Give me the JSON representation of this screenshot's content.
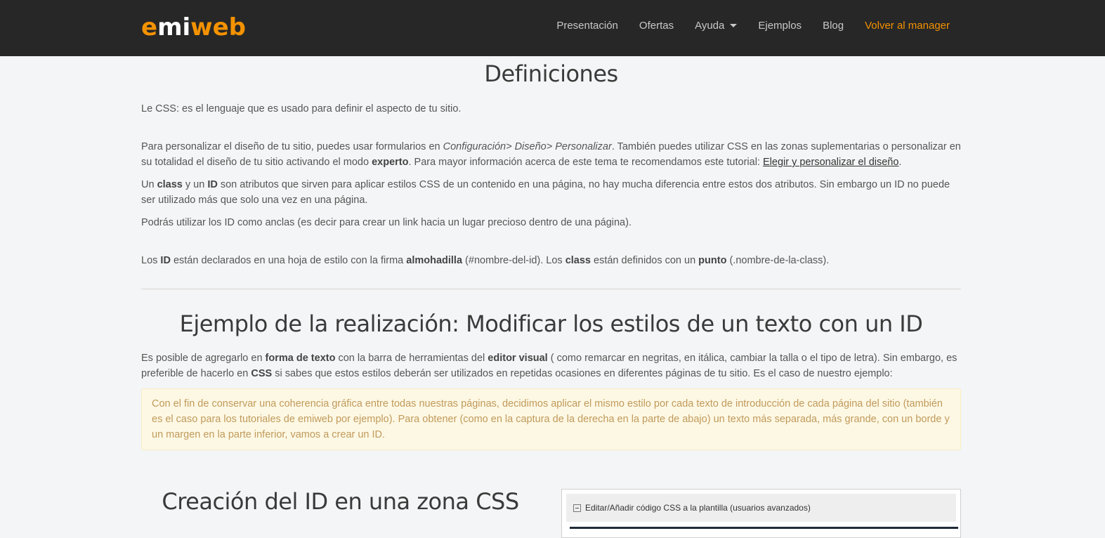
{
  "nav": {
    "logo_part1": "e",
    "logo_part2": "mi",
    "logo_part3": "web",
    "items": [
      "Presentación",
      "Ofertas",
      "Ayuda",
      "Ejemplos",
      "Blog"
    ],
    "manager_link": "Volver al manager"
  },
  "definiciones": {
    "title": "Definiciones",
    "p1": "Le CSS: es el lenguaje que es usado para definir el aspecto de tu sitio.",
    "p2a": "Para personalizar el diseño de tu sitio, puedes usar formularios en ",
    "p2_path": "Configuración> Diseño> Personalizar",
    "p2b": ". También puedes utilizar CSS en las zonas suplementarias o personalizar en su totalidad el diseño de tu sitio activando el modo ",
    "p2_bold": "experto",
    "p2c": ". Para mayor información acerca de este tema te recomendamos este tutorial: ",
    "p2_link": "Elegir y personalizar el diseño",
    "p2d": ".",
    "p3a": "Un ",
    "p3_class": "class",
    "p3b": " y un ",
    "p3_id": "ID",
    "p3c": " son atributos que sirven para aplicar estilos CSS de un contenido en una página, no hay mucha diferencia entre estos dos atributos. Sin embargo un ID no puede ser utilizado más que solo una vez en una página.",
    "p4": "Podrás utilizar los ID como anclas (es decir para crear un link hacia un lugar precioso dentro de una página).",
    "p5a": "Los ",
    "p5_id": "ID",
    "p5b": " están declarados en una hoja de estilo con la firma ",
    "p5_alm": "almohadilla",
    "p5c": " (#nombre-del-id). Los ",
    "p5_class": "class",
    "p5d": " están definidos con un ",
    "p5_punto": "punto",
    "p5e": " (.nombre-de-la-class)."
  },
  "ejemplo": {
    "title": "Ejemplo de la realización: Modificar los estilos de un texto con un ID",
    "p1a": "Es posible de agregarlo en ",
    "p1_forma": "forma de texto",
    "p1b": " con la barra de herramientas del ",
    "p1_editor": "editor visual",
    "p1c": " ( como remarcar en negritas, en itálica, cambiar la talla o el tipo de letra). Sin embargo, es preferible de hacerlo en ",
    "p1_css": "CSS",
    "p1d": " si sabes que estos estilos deberán ser utilizados en repetidas ocasiones en diferentes páginas de tu sitio. Es el caso de nuestro ejemplo:",
    "alert": "Con el fin de conservar una coherencia gráfica entre todas nuestras páginas, decidimos aplicar el mismo estilo por cada texto de introducción de cada página del sitio (también es el caso para los tutoriales de emiweb por ejemplo). Para obtener (como en la captura de la derecha en la parte de abajo) un texto más separada, más grande, con un borde y un margen en la parte inferior, vamos a crear un ID."
  },
  "creacion": {
    "title": "Creación del ID en una zona CSS",
    "panel_label": "Editar/Añadir código CSS a la plantilla (usuarios avanzados)"
  },
  "colors": {
    "accent": "#f39200",
    "navbar": "#272727",
    "alert_bg": "#fdf8e4",
    "alert_text": "#c19a5b"
  }
}
